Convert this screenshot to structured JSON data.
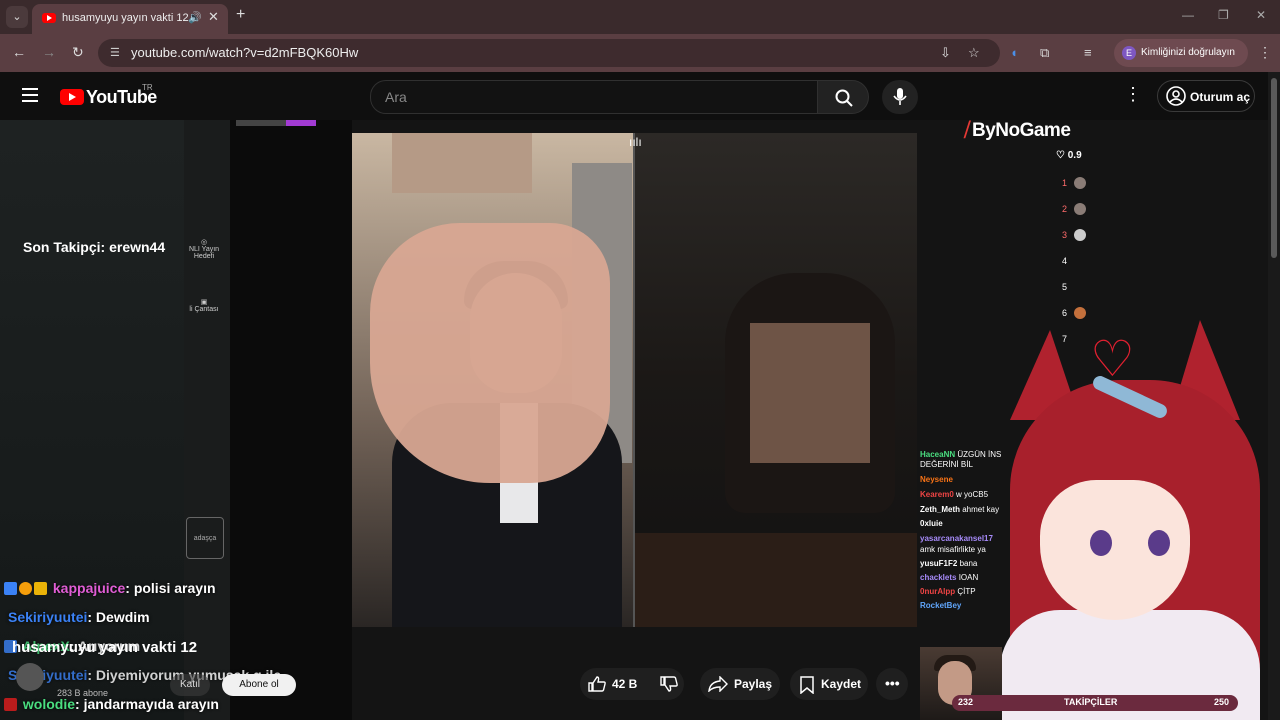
{
  "browser": {
    "tab_title": "husamyuyu yayın vakti 12",
    "url": "youtube.com/watch?v=d2mFBQK60Hw",
    "verify_label": "Kimliğinizi doğrulayın",
    "verify_avatar": "E"
  },
  "youtube": {
    "logo_text": "YouTube",
    "country_code": "TR",
    "search_placeholder": "Ara",
    "signin_label": "Oturum aç"
  },
  "stream": {
    "last_follower": "Son Takipçi: erewn44",
    "brand": "ByNoGame",
    "viewers": "♡ 0.9",
    "ranks": [
      "1",
      "2",
      "3",
      "4",
      "5",
      "6",
      "7"
    ],
    "sidebar_left": [
      "NLI Yayın Hedefi",
      "li Çantası"
    ],
    "sidebar_box": "adaşça",
    "followers_bar": {
      "left": "232",
      "center": "TAKİPÇİLER",
      "right": "250"
    }
  },
  "chat_overlay": [
    {
      "user": "kappajuice",
      "msg": ": polisi arayın",
      "color": "#e05dd5"
    },
    {
      "user": "Sekiriyuutei",
      "msg": ": Dewdim",
      "color": "#3b82f6"
    },
    {
      "user": "AlpexX",
      "msg": ": Arıyorum",
      "color": "#4ade80"
    },
    {
      "user": "Sekiriyuutei",
      "msg": ": Diyemiyorum yumuşak g ile",
      "color": "#3b82f6"
    },
    {
      "user": "wolodie",
      "msg": ": jandarmayıda arayın",
      "color": "#4ade80"
    }
  ],
  "right_chat": [
    {
      "user": "HaceaNN",
      "msg": " ÜZGÜN İNS",
      "color": "#4ade80"
    },
    {
      "user": "",
      "msg": "DEĞERİNİ BİL",
      "color": "#fff"
    },
    {
      "user": "Neysene",
      "msg": "",
      "color": "#f97316"
    },
    {
      "user": "Kearem0",
      "msg": " w yoCB5",
      "color": "#ef4444"
    },
    {
      "user": "Zeth_Meth",
      "msg": " ahmet kay",
      "color": "#fff"
    },
    {
      "user": "0xluie",
      "msg": "",
      "color": "#fff"
    },
    {
      "user": "yasarcanakansel17",
      "msg": "",
      "color": "#a78bfa"
    },
    {
      "user": "",
      "msg": "amk misafirlikte ya",
      "color": "#fff"
    },
    {
      "user": "yusuF1F2",
      "msg": " bana",
      "color": "#fff"
    },
    {
      "user": "chacklets",
      "msg": " IOAN",
      "color": "#a78bfa"
    },
    {
      "user": "0nurAlpp",
      "msg": " ÇİTP",
      "color": "#ef4444"
    },
    {
      "user": "RocketBey",
      "msg": "",
      "color": "#60a5fa"
    }
  ],
  "video_info": {
    "title": "husamyuyu yayın vakti 12",
    "subs": "283 B abone",
    "join_label": "Katıl",
    "subscribe_label": "Abone ol"
  },
  "actions": {
    "likes": "42 B",
    "share": "Paylaş",
    "save": "Kaydet"
  }
}
